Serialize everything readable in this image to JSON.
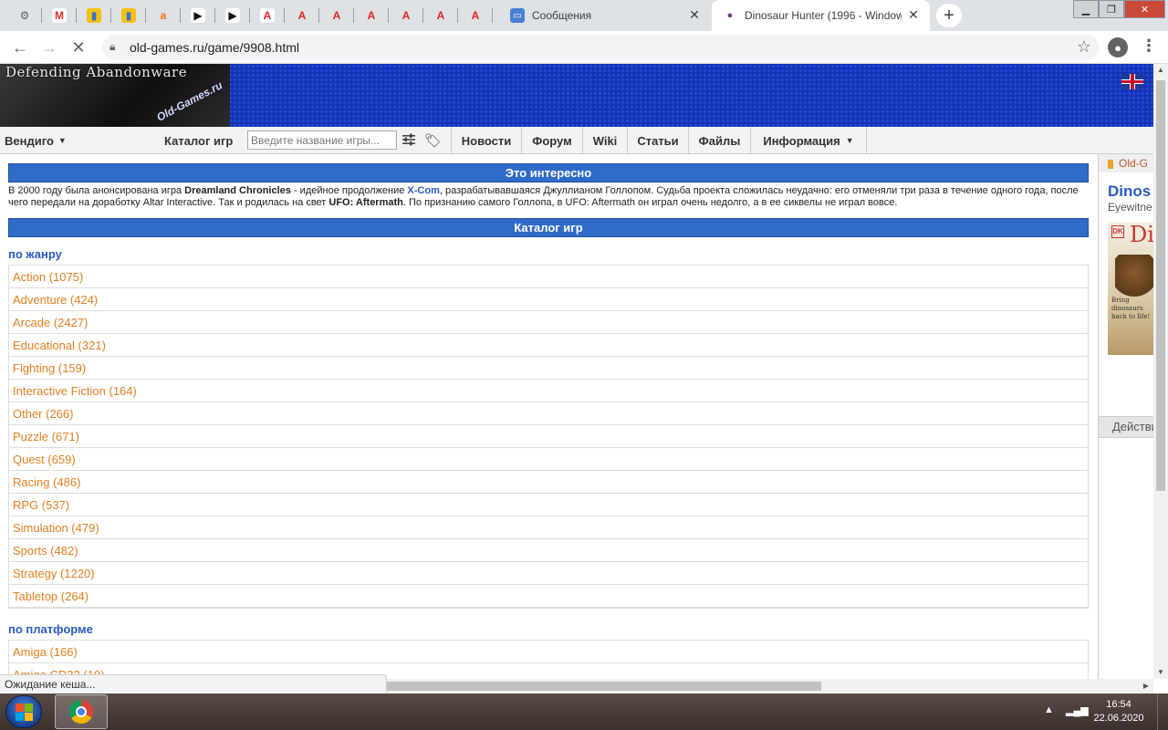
{
  "browser": {
    "tabs": [
      {
        "icon": "chrome-settings-icon",
        "glyph": "⚙",
        "color": "#5f6368",
        "bg": "#dee1e6"
      },
      {
        "icon": "gmail-icon",
        "glyph": "M",
        "color": "#d93025",
        "bg": "#ffffff"
      },
      {
        "icon": "shopping-bag-icon",
        "glyph": "▮",
        "color": "#3b6fd4",
        "bg": "#f4c20d"
      },
      {
        "icon": "shopping-bag-icon",
        "glyph": "▮",
        "color": "#3b6fd4",
        "bg": "#f4c20d"
      },
      {
        "icon": "avito-icon",
        "glyph": "a",
        "color": "#ff6a00",
        "bg": "#dee1e6"
      },
      {
        "icon": "media-icon",
        "glyph": "▶",
        "color": "#111111",
        "bg": "#ffffff"
      },
      {
        "icon": "media-icon",
        "glyph": "▶",
        "color": "#111111",
        "bg": "#ffffff"
      },
      {
        "icon": "letter-a-icon",
        "glyph": "A",
        "color": "#e32222",
        "bg": "#ffffff"
      },
      {
        "icon": "red-a-icon",
        "glyph": "A",
        "color": "#e32222",
        "bg": "#dee1e6"
      },
      {
        "icon": "red-a-icon",
        "glyph": "A",
        "color": "#e32222",
        "bg": "#dee1e6"
      },
      {
        "icon": "red-a-icon",
        "glyph": "A",
        "color": "#e32222",
        "bg": "#dee1e6"
      },
      {
        "icon": "red-a-icon",
        "glyph": "A",
        "color": "#e32222",
        "bg": "#dee1e6"
      },
      {
        "icon": "red-a-icon",
        "glyph": "A",
        "color": "#e32222",
        "bg": "#dee1e6"
      },
      {
        "icon": "red-a-icon",
        "glyph": "A",
        "color": "#e32222",
        "bg": "#dee1e6"
      }
    ],
    "messages_tab": {
      "title": "Сообщения",
      "icon": "chat-icon",
      "close": "✕"
    },
    "active_tab": {
      "title": "Dinosaur Hunter (1996 - Window",
      "icon": "old-games-icon",
      "close": "✕"
    },
    "new_tab": "+",
    "url": "old-games.ru/game/9908.html",
    "status": "Ожидание кеша..."
  },
  "site": {
    "logo_text": "Defending Abandonware",
    "logo_sub": "Old-Games.ru",
    "nav": {
      "vendigo": "Вендиго",
      "catalog_label": "Каталог игр",
      "search_placeholder": "Введите название игры...",
      "items": [
        "Новости",
        "Форум",
        "Wiki",
        "Статьи",
        "Файлы",
        "Информация"
      ]
    }
  },
  "interesting": {
    "header": "Это интересно",
    "p1": "В 2000 году была анонсирована игра ",
    "game1": "Dreamland Chronicles",
    "p2": " - идейное продолжение ",
    "game2": "X-Com",
    "p3": ", разрабатывавшаяся Джуллианом Голлопом. Судьба проекта сложилась неудачно: его отменяли три раза в течение одного года, после чего передали на доработку Altar Interactive. Так и родилась на свет ",
    "game3": "UFO: Aftermath",
    "p4": ". По признанию самого Голлопа, в UFO: Aftermath он играл очень недолго, а в ее сиквелы не играл вовсе."
  },
  "catalog": {
    "header": "Каталог игр",
    "by_genre_title": "по жанру",
    "genres": [
      "Action (1075)",
      "Adventure (424)",
      "Arcade (2427)",
      "Educational (321)",
      "Fighting (159)",
      "Interactive Fiction (164)",
      "Other (266)",
      "Puzzle (671)",
      "Quest (659)",
      "Racing (486)",
      "RPG (537)",
      "Simulation (479)",
      "Sports (482)",
      "Strategy (1220)",
      "Tabletop (264)"
    ],
    "by_platform_title": "по платформе",
    "platforms": [
      "Amiga (166)",
      "Amiga CD32 (10)"
    ]
  },
  "sidebar": {
    "bar": "Old-G",
    "title": "Dinos",
    "sub": "Eyewitne",
    "cover_logo": "DK",
    "cover_letter": "Di",
    "cover_tag": "Bring dinosaurs back to life!",
    "actions": "Действи"
  },
  "taskbar": {
    "time": "16:54",
    "date": "22.06.2020"
  },
  "colors": {
    "header_blue": "#2f6bc8",
    "link_orange": "#e08020",
    "title_blue": "#2a5bbf"
  }
}
